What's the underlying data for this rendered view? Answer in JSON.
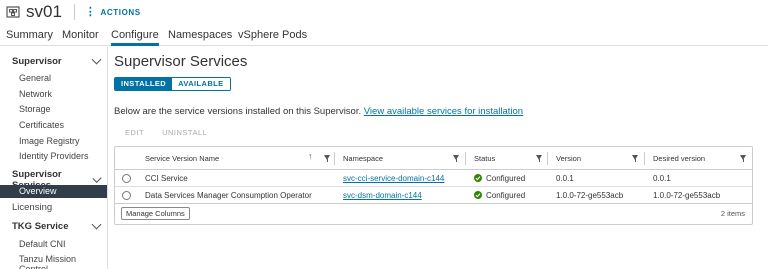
{
  "header": {
    "object_name": "sv01",
    "actions_label": "ACTIONS"
  },
  "tabs": [
    {
      "label": "Summary"
    },
    {
      "label": "Monitor"
    },
    {
      "label": "Configure",
      "active": true
    },
    {
      "label": "Namespaces"
    },
    {
      "label": "vSphere Pods"
    }
  ],
  "sidebar": {
    "supervisor": {
      "title": "Supervisor",
      "items": [
        "General",
        "Network",
        "Storage",
        "Certificates",
        "Image Registry",
        "Identity Providers"
      ]
    },
    "supervisor_services": {
      "title": "Supervisor Services",
      "items": [
        "Overview"
      ]
    },
    "licensing": "Licensing",
    "tkg_service": {
      "title": "TKG Service",
      "items": [
        "Default CNI",
        "Tanzu Mission Control"
      ]
    }
  },
  "main": {
    "title": "Supervisor Services",
    "toggle": {
      "installed": "INSTALLED",
      "available": "AVAILABLE"
    },
    "description": "Below are the service versions installed on this Supervisor. ",
    "description_link": "View available services for installation",
    "actions": {
      "edit": "EDIT",
      "uninstall": "UNINSTALL"
    },
    "grid": {
      "columns": [
        "Service Version Name",
        "Namespace",
        "Status",
        "Version",
        "Desired version"
      ],
      "rows": [
        {
          "name": "CCI Service",
          "namespace": "svc-cci-service-domain-c144",
          "status": "Configured",
          "version": "0.0.1",
          "desired": "0.0.1"
        },
        {
          "name": "Data Services Manager Consumption Operator",
          "namespace": "svc-dsm-domain-c144",
          "status": "Configured",
          "version": "1.0.0-72-ge553acb",
          "desired": "1.0.0-72-ge553acb"
        }
      ],
      "manage_columns": "Manage Columns",
      "item_count": "2 items"
    }
  },
  "colors": {
    "accent": "#0072a3",
    "sidebar_active": "#313d4b",
    "status_ok": "#318700"
  }
}
